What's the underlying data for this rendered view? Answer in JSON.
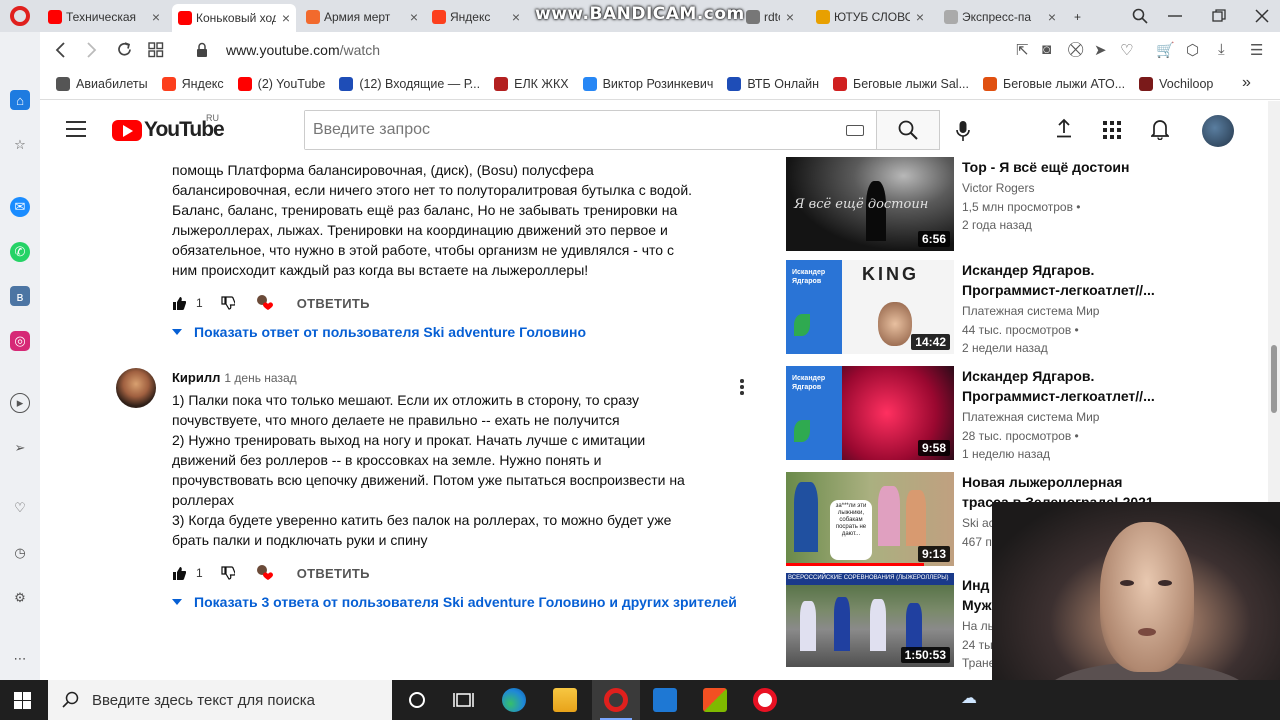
{
  "browser": {
    "tabs": [
      {
        "label": "Техническая",
        "color": "#ff0000"
      },
      {
        "label": "Коньковый ход",
        "color": "#ff0000",
        "active": true
      },
      {
        "label": "Армия мерт",
        "color": "#f26a2d"
      },
      {
        "label": "Яндекс",
        "color": "#fc3f1d"
      },
      {
        "label": "rdtool",
        "color": "#777777"
      },
      {
        "label": "ЮТУБ СЛОВО",
        "color": "#e8a000"
      },
      {
        "label": "Экспресс-па",
        "color": "#aaaaaa"
      }
    ],
    "watermark": "www.BANDICAM.com",
    "url_host": "www.youtube.com",
    "url_path": "/watch",
    "bookmarks": [
      {
        "label": "Авиабилеты",
        "color": "#555555"
      },
      {
        "label": "Яндекс",
        "color": "#fc3f1d"
      },
      {
        "label": "(2) YouTube",
        "color": "#ff0000"
      },
      {
        "label": "(12) Входящие — Р...",
        "color": "#1e4db7"
      },
      {
        "label": "ЕЛК ЖКХ",
        "color": "#b32020"
      },
      {
        "label": "Виктор Розинкевич",
        "color": "#2787f5"
      },
      {
        "label": "ВТБ Онлайн",
        "color": "#1e4db7"
      },
      {
        "label": "Беговые лыжи Sal...",
        "color": "#d02020"
      },
      {
        "label": "Беговые лыжи АТО...",
        "color": "#e05010"
      },
      {
        "label": "Vochiloop",
        "color": "#7a1a1a"
      }
    ],
    "bookmarks_more": "»"
  },
  "youtube": {
    "logo_text": "YouTube",
    "region": "RU",
    "search_placeholder": "Введите запрос"
  },
  "comments": {
    "partial": {
      "lines": [
        "помощь Платформа балансировочная, (диск), (Bosu) полусфера",
        "балансировочная, если ничего этого нет то полуторалитровая бутылка с водой.",
        "Баланс, баланс, тренировать ещё раз баланс, Но не забывать тренировки на",
        "лыжероллерах, лыжах. Тренировки на координацию движений это первое и",
        "обязательное, что нужно в этой работе, чтобы организм не удивлялся - что с",
        "ним происходит каждый раз когда вы встаете на лыжероллеры!"
      ],
      "likes": "1",
      "reply_label": "ОТВЕТИТЬ",
      "show_replies": "Показать ответ от пользователя Ski adventure Головино"
    },
    "second": {
      "author": "Кирилл",
      "time": "1 день назад",
      "lines": [
        "1) Палки пока что только мешают. Если их отложить в сторону, то сразу",
        "почувствуете, что много делаете не правильно -- ехать не получится",
        "2) Нужно тренировать выход на ногу и прокат. Начать лучше с имитации",
        "движений без роллеров -- в кроссовках на земле. Нужно понять и",
        "прочувствовать всю цепочку движений. Потом уже пытаться воспроизвести на",
        "роллерах",
        "3) Когда будете уверенно катить без палок на роллерах, то можно будет уже",
        "брать палки и подключать руки и спину"
      ],
      "likes": "1",
      "reply_label": "ОТВЕТИТЬ",
      "show_replies": "Показать 3 ответа от пользователя Ski adventure Головино и других зрителей"
    }
  },
  "videos": [
    {
      "title1": "Тор - Я всё ещё достоин",
      "title2": "",
      "channel": "Victor Rogers",
      "views": "1,5 млн просмотров •",
      "age": "2 года назад",
      "duration": "6:56",
      "thumb_text": "Я всё ещё достоин"
    },
    {
      "title1": "Искандер Ядгаров.",
      "title2": "Программист-легкоатлет//...",
      "channel": "Платежная система Мир",
      "views": "44 тыс. просмотров •",
      "age": "2 недели назад",
      "duration": "14:42",
      "thumb_text": "Искандер Ядгаров",
      "thumb_sub": "KING"
    },
    {
      "title1": "Искандер Ядгаров.",
      "title2": "Программист-легкоатлет//...",
      "channel": "Платежная система Мир",
      "views": "28 тыс. просмотров •",
      "age": "1 неделю назад",
      "duration": "9:58",
      "thumb_text": "Искандер Ядгаров"
    },
    {
      "title1": "Новая лыжероллерная",
      "title2": "трасса в Зеленограде! 2021",
      "channel": "Ski ac",
      "views": "467 п",
      "age": "",
      "duration": "9:13",
      "thumb_text": "за***ли эти лыжники, собакам посрать не дают..."
    },
    {
      "title1": "Инд",
      "title2": "Муж",
      "channel": "На лы",
      "views": "24 ты",
      "age": "Тране",
      "duration": "1:50:53",
      "thumb_text": "ВСЕРОССИЙСКИЕ СОРЕВНОВАНИЯ (ЛЫЖЕРОЛЛЕРЫ)"
    }
  ],
  "taskbar": {
    "search_placeholder": "Введите здесь текст для поиска"
  }
}
